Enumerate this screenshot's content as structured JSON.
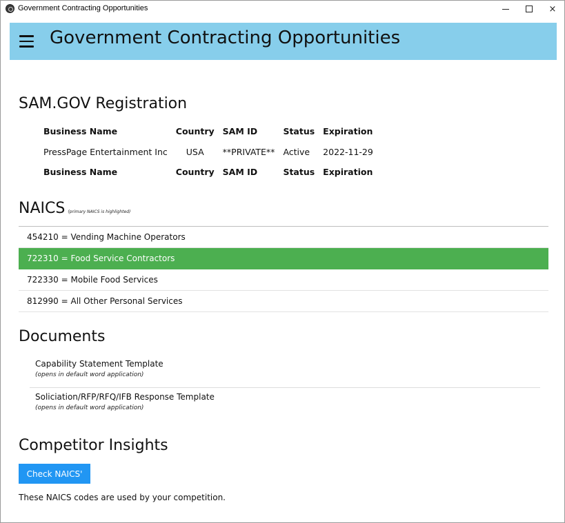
{
  "window": {
    "title": "Government Contracting Opportunities",
    "controls": {
      "minimize": "minimize",
      "maximize": "maximize",
      "close": "×"
    }
  },
  "header": {
    "title": "Government Contracting Opportunities",
    "menu_icon": "hamburger-menu-icon",
    "background": "#87ceeb"
  },
  "sam": {
    "heading": "SAM.GOV Registration",
    "columns": [
      "Business Name",
      "Country",
      "SAM ID",
      "Status",
      "Expiration"
    ],
    "rows": [
      [
        "PressPage Entertainment Inc",
        "USA",
        "**PRIVATE**",
        "Active",
        "2022-11-29"
      ]
    ]
  },
  "naics": {
    "heading": "NAICS",
    "note": "(primary NAICS is highlighted)",
    "highlight_color": "#4caf50",
    "items": [
      {
        "label": "454210 = Vending Machine Operators",
        "primary": false
      },
      {
        "label": "722310 = Food Service Contractors",
        "primary": true
      },
      {
        "label": "722330 = Mobile Food Services",
        "primary": false
      },
      {
        "label": "812990 = All Other Personal Services",
        "primary": false
      }
    ]
  },
  "documents": {
    "heading": "Documents",
    "items": [
      {
        "name": "Capability Statement Template",
        "hint": "(opens in default word application)"
      },
      {
        "name": "Soliciation/RFP/RFQ/IFB Response Template",
        "hint": "(opens in default word application)"
      }
    ]
  },
  "competitor": {
    "heading": "Competitor Insights",
    "button_label": "Check NAICS'",
    "button_color": "#2196f3",
    "note": "These NAICS codes are used by your competition."
  }
}
